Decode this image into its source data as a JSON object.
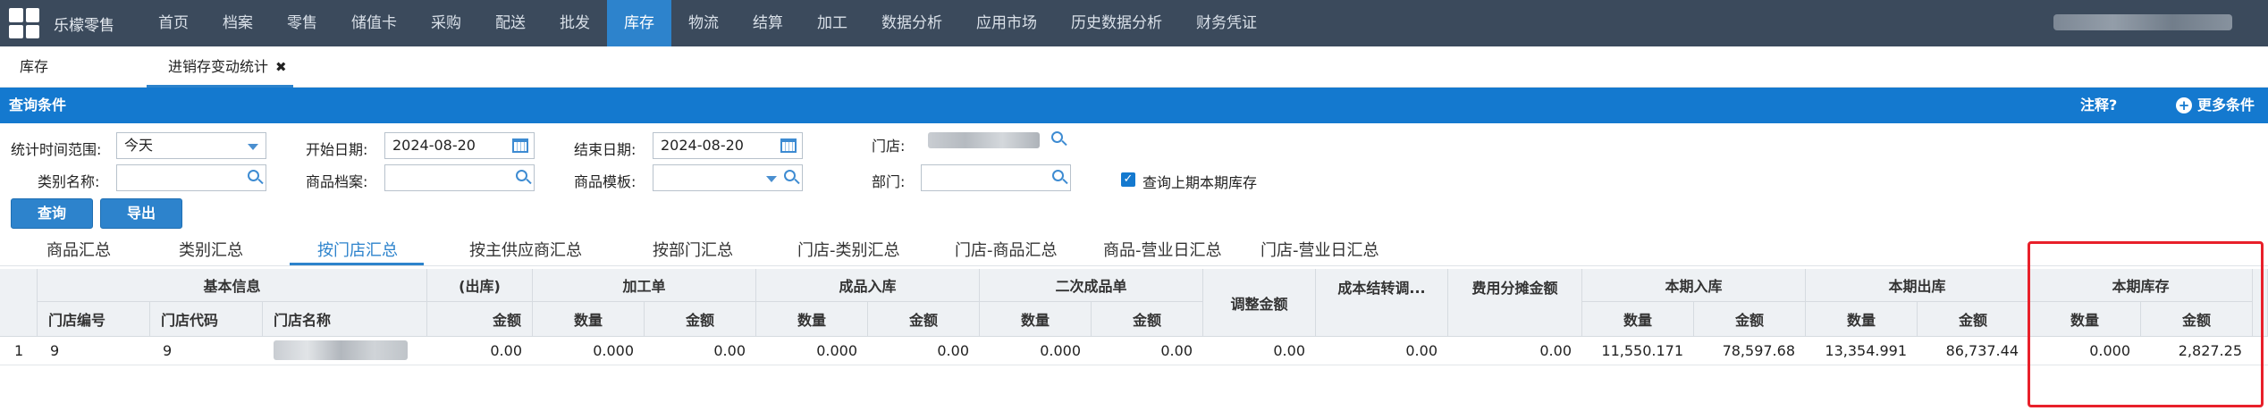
{
  "nav": {
    "brand": "乐檬零售",
    "items": [
      "首页",
      "档案",
      "零售",
      "储值卡",
      "采购",
      "配送",
      "批发",
      "库存",
      "物流",
      "结算",
      "加工",
      "数据分析",
      "应用市场",
      "历史数据分析",
      "财务凭证"
    ],
    "active": "库存"
  },
  "page_tabs": {
    "tab1": "库存",
    "tab2": "进销存变动统计",
    "close": "✖"
  },
  "query_bar": {
    "title": "查询条件",
    "help": "注释?",
    "more": "更多条件"
  },
  "filters": {
    "range_label": "统计时间范围:",
    "range_value": "今天",
    "start_label": "开始日期:",
    "start_value": "2024-08-20",
    "end_label": "结束日期:",
    "end_value": "2024-08-20",
    "store_label": "门店:",
    "category_label": "类别名称:",
    "product_label": "商品档案:",
    "template_label": "商品模板:",
    "dept_label": "部门:",
    "prev_stock_label": "查询上期本期库存"
  },
  "buttons": {
    "query": "查询",
    "export": "导出"
  },
  "sub_tabs": [
    "商品汇总",
    "类别汇总",
    "按门店汇总",
    "按主供应商汇总",
    "按部门汇总",
    "门店-类别汇总",
    "门店-商品汇总",
    "商品-营业日汇总",
    "门店-营业日汇总"
  ],
  "active_sub_tab": "按门店汇总",
  "table": {
    "group_headers": {
      "basic": "基本信息",
      "out": "(出库)",
      "process": "加工单",
      "finished_in": "成品入库",
      "secondary": "二次成品单",
      "adjust": "调整金额",
      "cost_carry": "成本结转调...",
      "fee_share": "费用分摊金额",
      "period_in": "本期入库",
      "period_out": "本期出库",
      "period_stock": "本期库存"
    },
    "sub_headers": {
      "store_no": "门店编号",
      "store_code": "门店代码",
      "store_name": "门店名称",
      "amount": "金额",
      "qty": "数量"
    },
    "row": {
      "index": "1",
      "store_no": "9",
      "store_code": "9",
      "out_amount": "0.00",
      "process_qty": "0.000",
      "process_amount": "0.00",
      "finished_qty": "0.000",
      "finished_amount": "0.00",
      "secondary_qty": "0.000",
      "secondary_amount": "0.00",
      "adjust": "0.00",
      "cost_carry": "0.00",
      "fee_share": "0.00",
      "in_qty": "11,550.171",
      "in_amount": "78,597.68",
      "out_qty": "13,354.991",
      "out_amt": "86,737.44",
      "stock_qty": "0.000",
      "stock_amount": "2,827.25"
    }
  }
}
